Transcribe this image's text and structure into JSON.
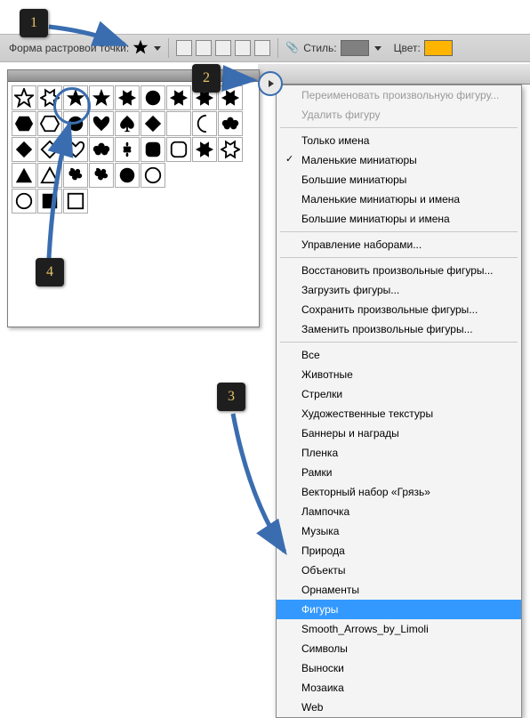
{
  "toolbar": {
    "shape_label": "Форма растровой точки:",
    "style_label": "Стиль:",
    "color_label": "Цвет:",
    "style_swatch": "#808080",
    "color_swatch": "#ffb400"
  },
  "markers": {
    "m1": "1",
    "m2": "2",
    "m3": "3",
    "m4": "4"
  },
  "menu": {
    "disabled": [
      "Переименовать произвольную фигуру...",
      "Удалить фигуру"
    ],
    "view": {
      "textOnly": "Только имена",
      "smallThumb": "Маленькие миниатюры",
      "largeThumb": "Большие миниатюры",
      "smallThumbName": "Маленькие миниатюры и имена",
      "largeThumbName": "Большие миниатюры и имена",
      "checked": "smallThumb"
    },
    "manage": "Управление наборами...",
    "ops": [
      "Восстановить произвольные фигуры...",
      "Загрузить фигуры...",
      "Сохранить произвольные фигуры...",
      "Заменить произвольные фигуры..."
    ],
    "sets": [
      "Все",
      "Животные",
      "Стрелки",
      "Художественные текстуры",
      "Баннеры и награды",
      "Пленка",
      "Рамки",
      "Векторный набор «Грязь»",
      "Лампочка",
      "Музыка",
      "Природа",
      "Объекты",
      "Орнаменты",
      "Фигуры",
      "Smooth_Arrows_by_Limoli",
      "Символы",
      "Выноски",
      "Мозаика",
      "Web"
    ],
    "highlighted": "Фигуры"
  },
  "shapes": [
    "star-outline",
    "burst-outline",
    "star",
    "star-thin",
    "burst",
    "blob",
    "seal",
    "seal2",
    "sun",
    "hex",
    "hex-outline",
    "circle",
    "heart",
    "spade",
    "diamond-round",
    "moon",
    "moon-outline",
    "club",
    "diamond",
    "diamond-outline",
    "heart-outline",
    "club2",
    "flower",
    "square-round",
    "square-round-outline",
    "seal3",
    "seal3-outline",
    "triangle",
    "triangle-outline",
    "splat",
    "splat2",
    "circle2",
    "circle-outline",
    "blank",
    "blank",
    "blank",
    "circle-outline2",
    "square",
    "square-outline"
  ],
  "colors": {
    "arrow": "#3a6db0",
    "circle": "#3a6db0"
  }
}
